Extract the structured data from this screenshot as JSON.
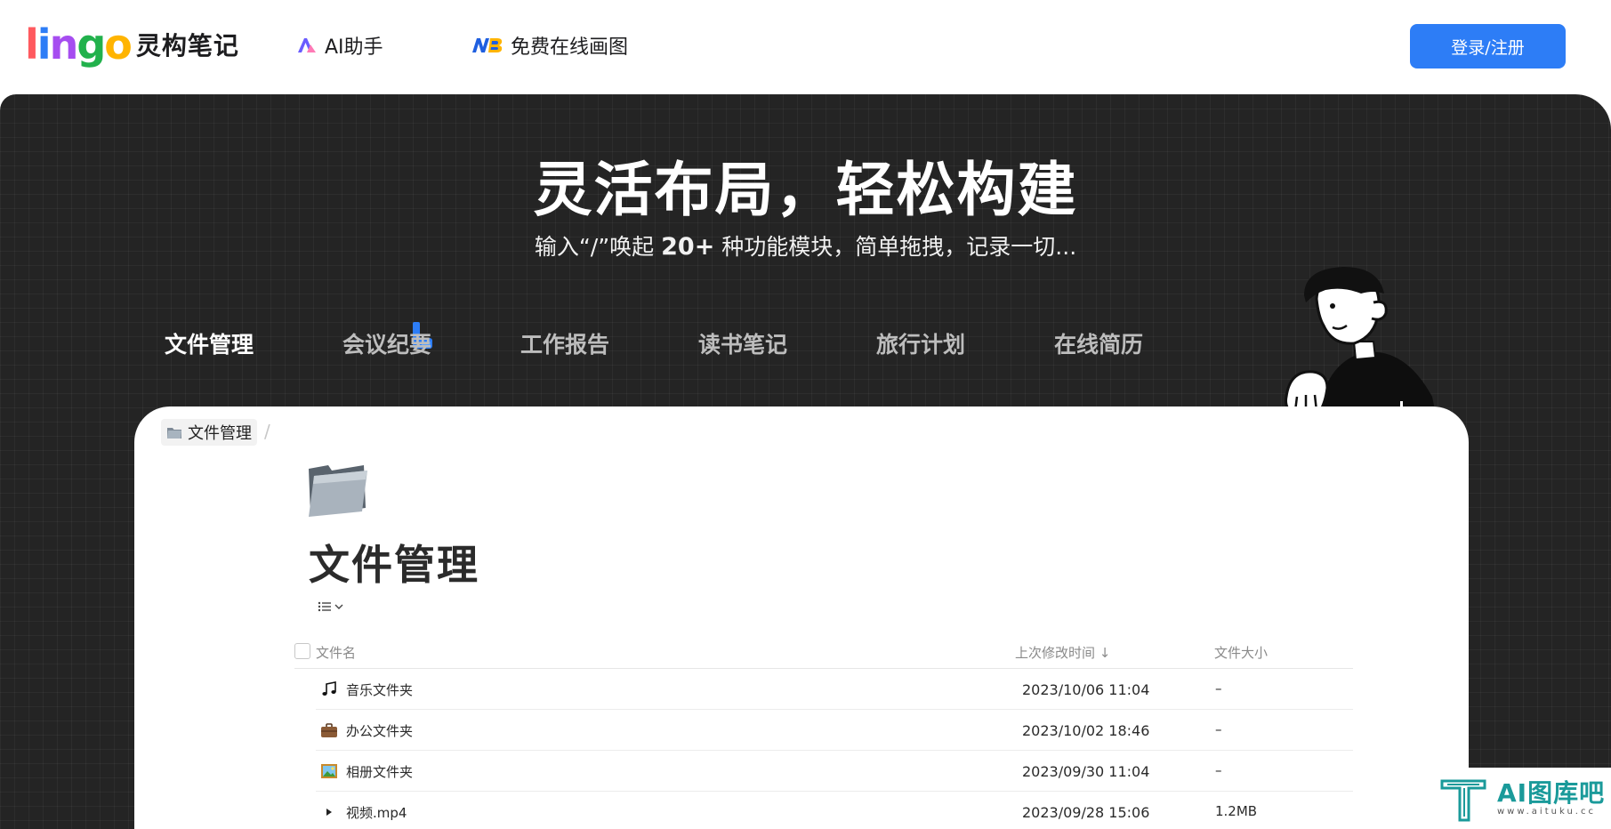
{
  "header": {
    "logo_letters": [
      "l",
      "i",
      "n",
      "g",
      "o"
    ],
    "logo_colors": [
      "#ff5a5f",
      "#2d7df6",
      "#a64df0",
      "#22b14c",
      "#ffb400"
    ],
    "app_name": "灵构笔记",
    "nav": [
      {
        "label": "AI助手",
        "icon": "ai-assistant-icon"
      },
      {
        "label": "免费在线画图",
        "icon": "draw-icon"
      }
    ],
    "login_label": "登录/注册",
    "accent": "#2d7df6"
  },
  "hero": {
    "title": "灵活布局，轻松构建",
    "subtitle_pre": "输入“/”唤起",
    "subtitle_strong": "20+",
    "subtitle_post": "种功能模块，简单拖拽，记录一切...",
    "tabs": [
      "文件管理",
      "会议纪要",
      "工作报告",
      "读书笔记",
      "旅行计划",
      "在线简历"
    ],
    "active_tab": 0
  },
  "card": {
    "breadcrumb": "文件管理",
    "breadcrumb_sep": "/",
    "title": "文件管理",
    "table": {
      "columns": [
        "文件名",
        "上次修改时间",
        "文件大小"
      ],
      "sort_indicator": "↓",
      "rows": [
        {
          "icon": "music-icon",
          "name": "音乐文件夹",
          "date": "2023/10/06 11:04",
          "size": "–"
        },
        {
          "icon": "briefcase-icon",
          "name": "办公文件夹",
          "date": "2023/10/02 18:46",
          "size": "–"
        },
        {
          "icon": "picture-icon",
          "name": "相册文件夹",
          "date": "2023/09/30 11:04",
          "size": "–"
        },
        {
          "icon": "play-icon",
          "name": "视频.mp4",
          "date": "2023/09/28 15:06",
          "size": "1.2MB"
        }
      ]
    }
  },
  "watermark": {
    "main": "AI图库吧",
    "sub": "www.aituku.cc"
  }
}
